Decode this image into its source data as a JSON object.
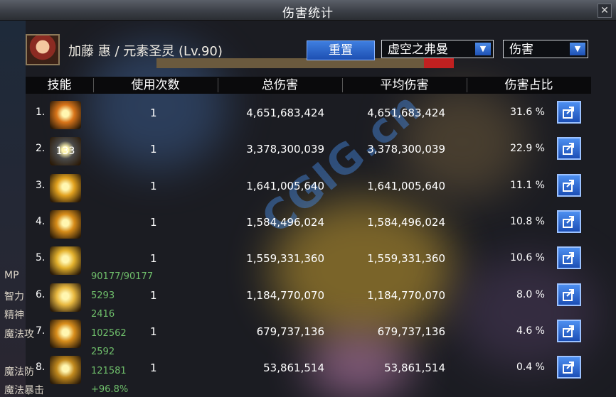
{
  "window": {
    "title": "伤害统计"
  },
  "character": {
    "name": "加藤 惠 / 元素圣灵 (Lv.90)"
  },
  "controls": {
    "reset_label": "重置",
    "dungeon_select": "虚空之弗曼",
    "metric_select": "伤害"
  },
  "table": {
    "headers": [
      "技能",
      "使用次数",
      "总伤害",
      "平均伤害",
      "伤害占比"
    ],
    "rows": [
      {
        "rank": "1.",
        "icon_text": "",
        "uses": "1",
        "total": "4,651,683,424",
        "avg": "4,651,683,424",
        "pct": "31.6 %",
        "icon_color": "#d9751a"
      },
      {
        "rank": "2.",
        "icon_text": "133",
        "uses": "1",
        "total": "3,378,300,039",
        "avg": "3,378,300,039",
        "pct": "22.9 %",
        "icon_color": "#4b4b4b"
      },
      {
        "rank": "3.",
        "icon_text": "",
        "uses": "1",
        "total": "1,641,005,640",
        "avg": "1,641,005,640",
        "pct": "11.1 %",
        "icon_color": "#e2a21f"
      },
      {
        "rank": "4.",
        "icon_text": "",
        "uses": "1",
        "total": "1,584,496,024",
        "avg": "1,584,496,024",
        "pct": "10.8 %",
        "icon_color": "#d78c19"
      },
      {
        "rank": "5.",
        "icon_text": "",
        "uses": "1",
        "total": "1,559,331,360",
        "avg": "1,559,331,360",
        "pct": "10.6 %",
        "icon_color": "#e3b12d"
      },
      {
        "rank": "6.",
        "icon_text": "",
        "uses": "1",
        "total": "1,184,770,070",
        "avg": "1,184,770,070",
        "pct": "8.0 %",
        "icon_color": "#e8b840"
      },
      {
        "rank": "7.",
        "icon_text": "",
        "uses": "1",
        "total": "679,737,136",
        "avg": "679,737,136",
        "pct": "4.6 %",
        "icon_color": "#d98e1c"
      },
      {
        "rank": "8.",
        "icon_text": "",
        "uses": "1",
        "total": "53,861,514",
        "avg": "53,861,514",
        "pct": "0.4 %",
        "icon_color": "#c28a1e"
      }
    ]
  },
  "background_stats": [
    {
      "label": "MP",
      "value": "90177/90177"
    },
    {
      "label": "智力",
      "value": "5293"
    },
    {
      "label": "精神",
      "value": "2416"
    },
    {
      "label": "魔法攻",
      "value": "102562"
    },
    {
      "label": "",
      "value": "2592"
    },
    {
      "label": "魔法防",
      "value": "121581"
    },
    {
      "label": "魔法暴击",
      "value": "+96.8%"
    }
  ],
  "watermark": "CGIG.cn",
  "icons": {
    "close": "close-icon",
    "dropdown": "chevron-down-icon",
    "share": "share-icon"
  }
}
